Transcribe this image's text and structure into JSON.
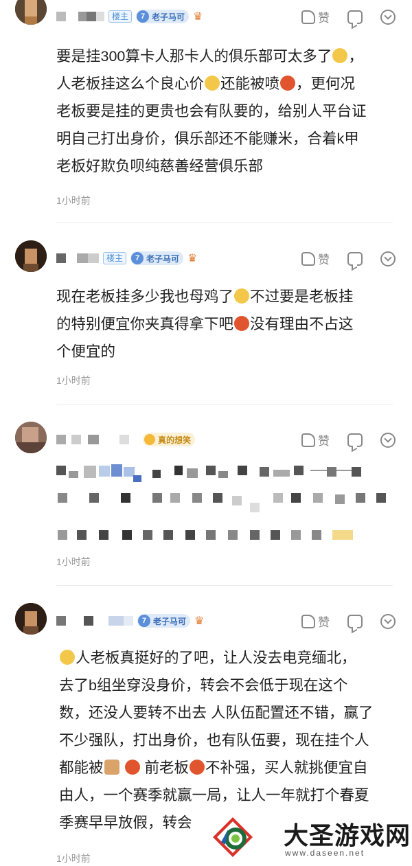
{
  "colors": {
    "accent_blue": "#4a8fd6",
    "gold": "#c48a16",
    "text": "#222222",
    "muted": "#999999"
  },
  "comments": [
    {
      "badges": {
        "owner": "楼主",
        "level": "7",
        "title": "老子马可"
      },
      "like_label": "赞",
      "text_lines": [
        "要是挂300算卡人那卡人的俱乐部可太多了",
        "人老板挂这么个良心价",
        "还能被喷",
        "，更何况",
        "老板要是挂的更贵也会有队要的，给别人平台证",
        "明自己打出身价，俱乐部还不能赚米，合着k甲",
        "老板好欺负呗纯慈善经营俱乐部"
      ],
      "time": "1小时前"
    },
    {
      "badges": {
        "owner": "楼主",
        "level": "7",
        "title": "老子马可"
      },
      "like_label": "赞",
      "text_lines": [
        "现在老板挂多少我也母鸡了",
        "不过要是老板挂",
        "的特别便宜你夹真得拿下吧",
        "没有理由不占这",
        "个便宜的"
      ],
      "time": "1小时前"
    },
    {
      "badges": {
        "title": "真的想笑"
      },
      "like_label": "赞",
      "time": "1小时前"
    },
    {
      "badges": {
        "level": "7",
        "title": "老子马可"
      },
      "like_label": "赞",
      "text_lines": [
        "人老板真挺好的了吧，让人没去电竞缅北，",
        "去了b组坐穿没身价，转会不会低于现在这个",
        "数，还没人要转不出去 人队伍配置还不错，赢了",
        "不少强队，打出身价，也有队伍要，现在挂个人",
        "都能被",
        "前老板",
        "不补强，买人就挑便宜自",
        "由人，一个赛季就赢一局，让人一年就打个春夏",
        "季赛早早放假，转会"
      ],
      "time": "1小时前"
    }
  ],
  "watermark": {
    "title": "大圣游戏网",
    "url": "www.daseen.net"
  }
}
